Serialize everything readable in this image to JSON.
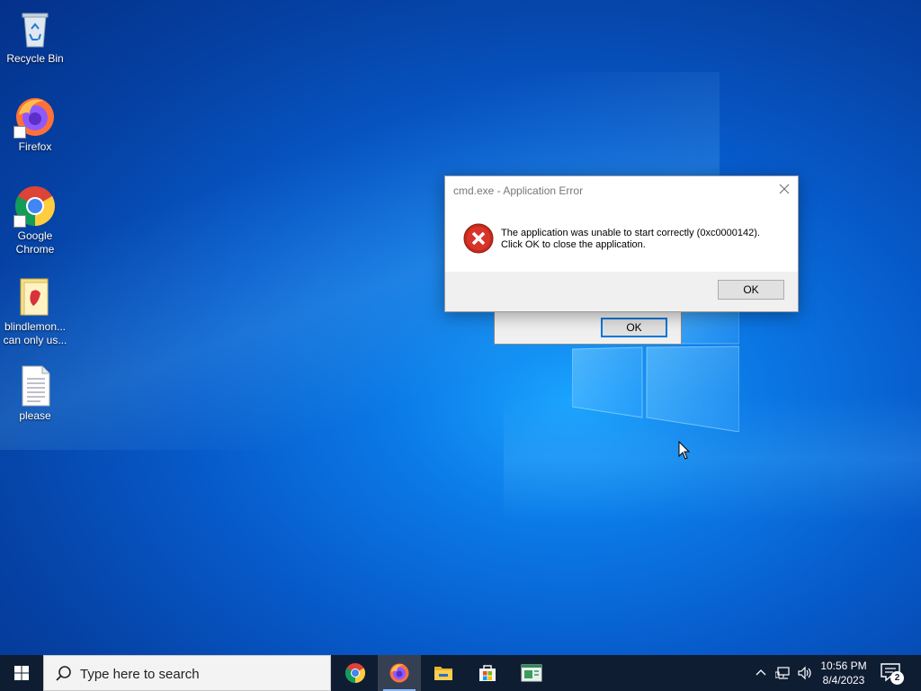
{
  "desktop": {
    "icons": [
      {
        "label": "Recycle Bin",
        "icon": "recycle-bin-icon"
      },
      {
        "label": "Firefox",
        "icon": "firefox-icon"
      },
      {
        "label": "Google Chrome",
        "icon": "chrome-icon"
      },
      {
        "label": "blindlemon... can only us...",
        "icon": "folder-icon"
      },
      {
        "label": "please",
        "icon": "text-document-icon"
      }
    ]
  },
  "background_dialog": {
    "ok_label": "OK"
  },
  "error_dialog": {
    "title": "cmd.exe - Application Error",
    "message_line1": "The application was unable to start correctly (0xc0000142).",
    "message_line2": "Click OK to close the application.",
    "ok_label": "OK",
    "icon": "error-icon"
  },
  "taskbar": {
    "search_placeholder": "Type here to search",
    "apps": [
      {
        "name": "Google Chrome",
        "icon": "chrome-icon",
        "active": false
      },
      {
        "name": "Firefox",
        "icon": "firefox-icon",
        "active": true
      },
      {
        "name": "File Explorer",
        "icon": "folder-icon",
        "active": false
      },
      {
        "name": "Microsoft Store",
        "icon": "store-icon",
        "active": false
      },
      {
        "name": "Terminal",
        "icon": "app-window-icon",
        "active": false
      }
    ],
    "clock_time": "10:56 PM",
    "clock_date": "8/4/2023",
    "notification_count": "2"
  },
  "colors": {
    "accent": "#0078d7",
    "taskbar": "#0f1d33",
    "error_red": "#c42b1c"
  }
}
